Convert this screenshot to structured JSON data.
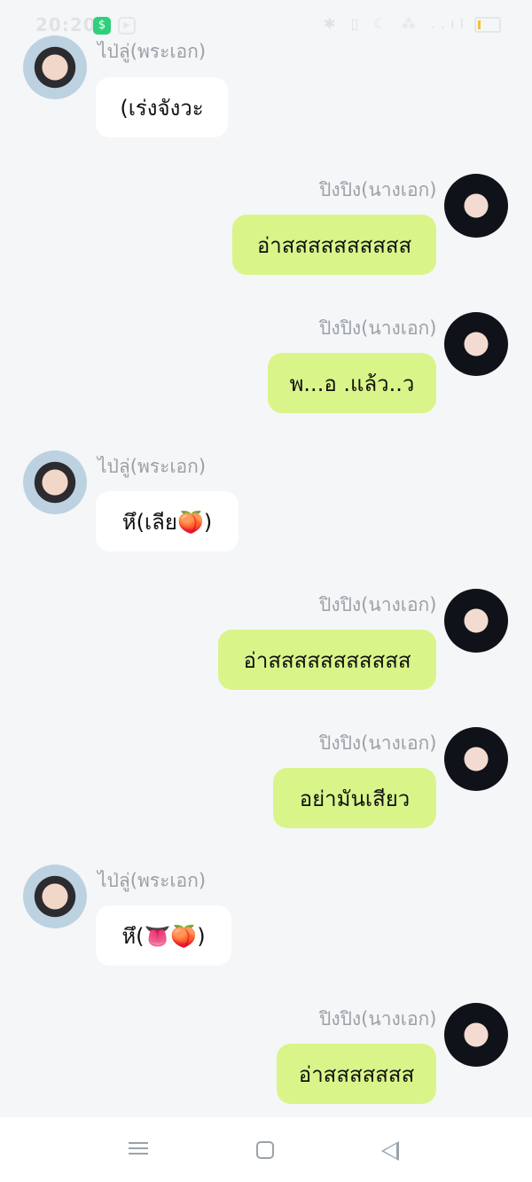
{
  "status": {
    "time": "20:20",
    "right_icons": "✱ ▯ ☾ ⁂ ..ıl"
  },
  "messages": [
    {
      "side": "left",
      "sender": "ไป่ลู่(พระเอก)",
      "text": "(เร่งจังวะ"
    },
    {
      "side": "right",
      "sender": "ปิงปิง(นางเอก)",
      "text": "อ่าสสสสสสสสสส"
    },
    {
      "side": "right",
      "sender": "ปิงปิง(นางเอก)",
      "text": "พ...อ .แล้ว..ว"
    },
    {
      "side": "left",
      "sender": "ไป่ลู่(พระเอก)",
      "text": "หึ(เลีย🍑)"
    },
    {
      "side": "right",
      "sender": "ปิงปิง(นางเอก)",
      "text": "อ่าสสสสสสสสสสส"
    },
    {
      "side": "right",
      "sender": "ปิงปิง(นางเอก)",
      "text": "อย่ามันเสียว"
    },
    {
      "side": "left",
      "sender": "ไป่ลู่(พระเอก)",
      "text": "หึ(👅🍑)"
    },
    {
      "side": "right",
      "sender": "ปิงปิง(นางเอก)",
      "text": "อ่าสสสสสสส"
    }
  ],
  "nav": {
    "icons": [
      "menu-icon",
      "home-icon",
      "back-icon"
    ]
  }
}
